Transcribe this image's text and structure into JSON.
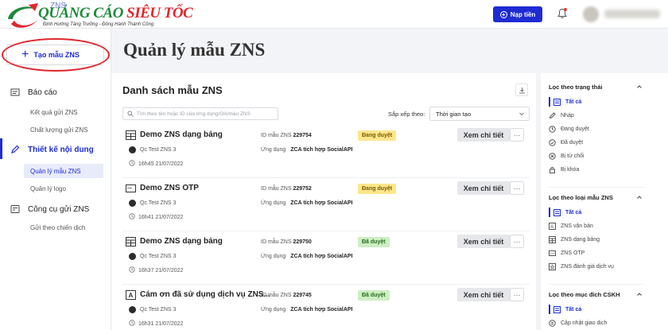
{
  "brand": {
    "logo_main_green": "QUẢNG CÁO ",
    "logo_main_red": "SIÊU TỐC",
    "logo_tagline": "Định Hướng Tăng Trưởng - Đồng Hành Thành Công",
    "app_name": "ZNS",
    "accent": "#1d2bd3",
    "highlight": "#e0262c"
  },
  "topbar": {
    "topup_label": "Nạp tiền"
  },
  "sidebar": {
    "create_label": "Tạo mẫu ZNS",
    "groups": [
      {
        "label": "Báo cáo",
        "items": [
          "Kết quả gửi ZNS",
          "Chất lượng gửi ZNS"
        ]
      },
      {
        "label": "Thiết kế nội dung",
        "items": [
          "Quản lý mẫu ZNS",
          "Quản lý logo"
        ]
      },
      {
        "label": "Công cụ gửi ZNS",
        "items": [
          "Gửi theo chiến dịch"
        ]
      }
    ]
  },
  "main": {
    "page_title": "Quản lý mẫu ZNS",
    "list_title": "Danh sách mẫu ZNS",
    "search_placeholder": "Tìm theo tên hoặc ID của ứng dụng/OA/mẫu ZNS",
    "sort_label": "Sắp xếp theo:",
    "sort_value": "Thời gian tạo",
    "id_label": "ID mẫu ZNS",
    "app_label": "Ứng dụng",
    "detail_label": "Xem chi tiết",
    "more_label": "···",
    "templates": [
      {
        "name": "Demo ZNS dạng bảng",
        "owner": "Qc Test ZNS 3",
        "time": "16h45 21/07/2022",
        "id": "229754",
        "app": "ZCA tích hợp SocialAPI",
        "status": "Đang duyệt",
        "icon": "table-icon"
      },
      {
        "name": "Demo ZNS OTP",
        "owner": "Qc Test ZNS 3",
        "time": "16h41 21/07/2022",
        "id": "229752",
        "app": "ZCA tích hợp SocialAPI",
        "status": "Đang duyệt",
        "icon": "otp-icon"
      },
      {
        "name": "Demo ZNS dạng bảng",
        "owner": "Qc Test ZNS 3",
        "time": "16h37 21/07/2022",
        "id": "229750",
        "app": "ZCA tích hợp SocialAPI",
        "status": "Đã duyệt",
        "icon": "table-icon"
      },
      {
        "name": "Cám ơn đã sử dụng dịch vụ ZNS...",
        "owner": "Qc Test ZNS 3",
        "time": "16h31 21/07/2022",
        "id": "229745",
        "app": "ZCA tích hợp SocialAPI",
        "status": "Đã duyệt",
        "icon": "text-icon"
      }
    ]
  },
  "filters": {
    "status": {
      "title": "Lọc theo trạng thái",
      "options": [
        "Tất cả",
        "Nháp",
        "Đang duyệt",
        "Đã duyệt",
        "Bị từ chối",
        "Bị khóa"
      ]
    },
    "type": {
      "title": "Lọc theo loại mẫu ZNS",
      "options": [
        "Tất cả",
        "ZNS văn bản",
        "ZNS dạng bảng",
        "ZNS OTP",
        "ZNS đánh giá dịch vụ"
      ]
    },
    "purpose": {
      "title": "Lọc theo mục đích CSKH",
      "options": [
        "Tất cả",
        "Cập nhật giao dịch"
      ]
    }
  }
}
